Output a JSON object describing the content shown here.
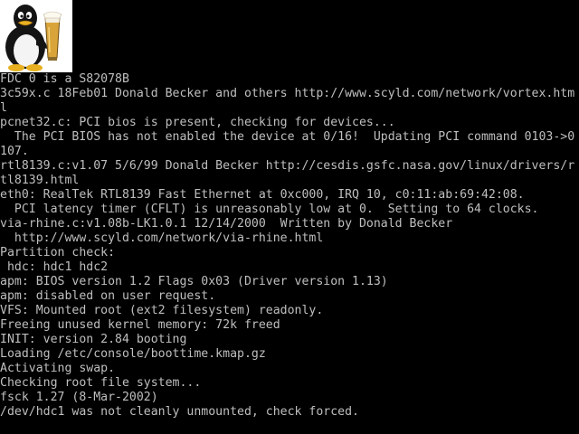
{
  "console": {
    "colors": {
      "background": "#000000",
      "text": "#bfbfbf"
    },
    "logo": {
      "icon": "tux-penguin-with-beer-icon"
    },
    "lines": [
      "FDC 0 is a S82078B",
      "3c59x.c 18Feb01 Donald Becker and others http://www.scyld.com/network/vortex.htm",
      "l",
      "pcnet32.c: PCI bios is present, checking for devices...",
      "  The PCI BIOS has not enabled the device at 0/16!  Updating PCI command 0103->0",
      "107.",
      "rtl8139.c:v1.07 5/6/99 Donald Becker http://cesdis.gsfc.nasa.gov/linux/drivers/r",
      "tl8139.html",
      "eth0: RealTek RTL8139 Fast Ethernet at 0xc000, IRQ 10, c0:11:ab:69:42:08.",
      "  PCI latency timer (CFLT) is unreasonably low at 0.  Setting to 64 clocks.",
      "via-rhine.c:v1.08b-LK1.0.1 12/14/2000  Written by Donald Becker",
      "  http://www.scyld.com/network/via-rhine.html",
      "Partition check:",
      " hdc: hdc1 hdc2",
      "apm: BIOS version 1.2 Flags 0x03 (Driver version 1.13)",
      "apm: disabled on user request.",
      "VFS: Mounted root (ext2 filesystem) readonly.",
      "Freeing unused kernel memory: 72k freed",
      "INIT: version 2.84 booting",
      "Loading /etc/console/boottime.kmap.gz",
      "Activating swap.",
      "Checking root file system...",
      "fsck 1.27 (8-Mar-2002)",
      "/dev/hdc1 was not cleanly unmounted, check forced."
    ]
  }
}
